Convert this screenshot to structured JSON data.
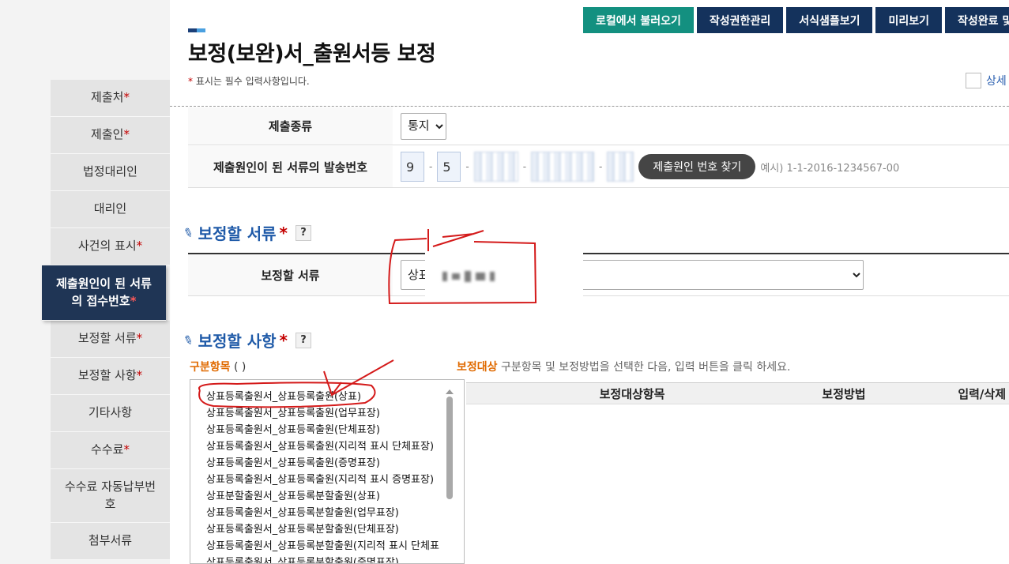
{
  "sidebar": {
    "items": [
      {
        "label": "제출처",
        "required": true
      },
      {
        "label": "제출인",
        "required": true
      },
      {
        "label": "법정대리인",
        "required": false
      },
      {
        "label": "대리인",
        "required": false
      },
      {
        "label": "사건의 표시",
        "required": true
      },
      {
        "label_line1": "제출원인이 된 서류",
        "label_line2": "의 접수번호",
        "required": true,
        "active": true
      },
      {
        "label": "보정할 서류",
        "required": true
      },
      {
        "label": "보정할 사항",
        "required": true
      },
      {
        "label": "기타사항",
        "required": false
      },
      {
        "label": "수수료",
        "required": true
      },
      {
        "label_line1": "수수료 자동납부번",
        "label_line2": "호",
        "required": false
      },
      {
        "label": "첨부서류",
        "required": false
      }
    ]
  },
  "toolbar": {
    "local_load": "로컬에서 불러오기",
    "permission": "작성권한관리",
    "sample": "서식샘플보기",
    "preview": "미리보기",
    "complete": "작성완료 및"
  },
  "page": {
    "title": "보정(보완)서_출원서등 보정",
    "required_note_star": "*",
    "required_note": " 표시는 필수 입력사항입니다.",
    "detail_label": "상세"
  },
  "form": {
    "submit_type_label": "제출종류",
    "submit_type_value": "통지",
    "dispatch_label": "제출원인이 된 서류의 발송번호",
    "dispatch_part1": "9",
    "dispatch_part2": "5",
    "find_button": "제출원인 번호 찾기",
    "example": "예시) 1-1-2016-1234567-00"
  },
  "section_docs": {
    "title": "보정할 서류",
    "star": "*",
    "help": "?",
    "label": "보정할 서류",
    "select_value": "상표"
  },
  "section_items": {
    "title": "보정할 사항",
    "star": "*",
    "help": "?",
    "category_label": "구분항목",
    "category_paren": " ( )",
    "guide_prefix": "보정대상",
    "guide_text": " 구분항목 및 보정방법을 선택한 다음, 입력 버튼을 클릭 하세요.",
    "list": [
      "상표등록출원서_상표등록출원(상표)",
      "상표등록출원서_상표등록출원(업무표장)",
      "상표등록출원서_상표등록출원(단체표장)",
      "상표등록출원서_상표등록출원(지리적 표시 단체표장)",
      "상표등록출원서_상표등록출원(증명표장)",
      "상표등록출원서_상표등록출원(지리적 표시 증명표장)",
      "상표분할출원서_상표등록분할출원(상표)",
      "상표등록출원서_상표등록분할출원(업무표장)",
      "상표등록출원서_상표등록분할출원(단체표장)",
      "상표등록출원서_상표등록분할출원(지리적 표시 단체표",
      "상표등록출원서_상표등록분할출원(증명표장)"
    ],
    "table_headers": {
      "target": "보정대상항목",
      "method": "보정방법",
      "action": "입력/삭제"
    }
  },
  "colors": {
    "navy": "#14325c",
    "teal": "#139080",
    "accent_blue": "#1f5aa8",
    "required_red": "#c40000",
    "annotation_red": "#d41a1a"
  }
}
